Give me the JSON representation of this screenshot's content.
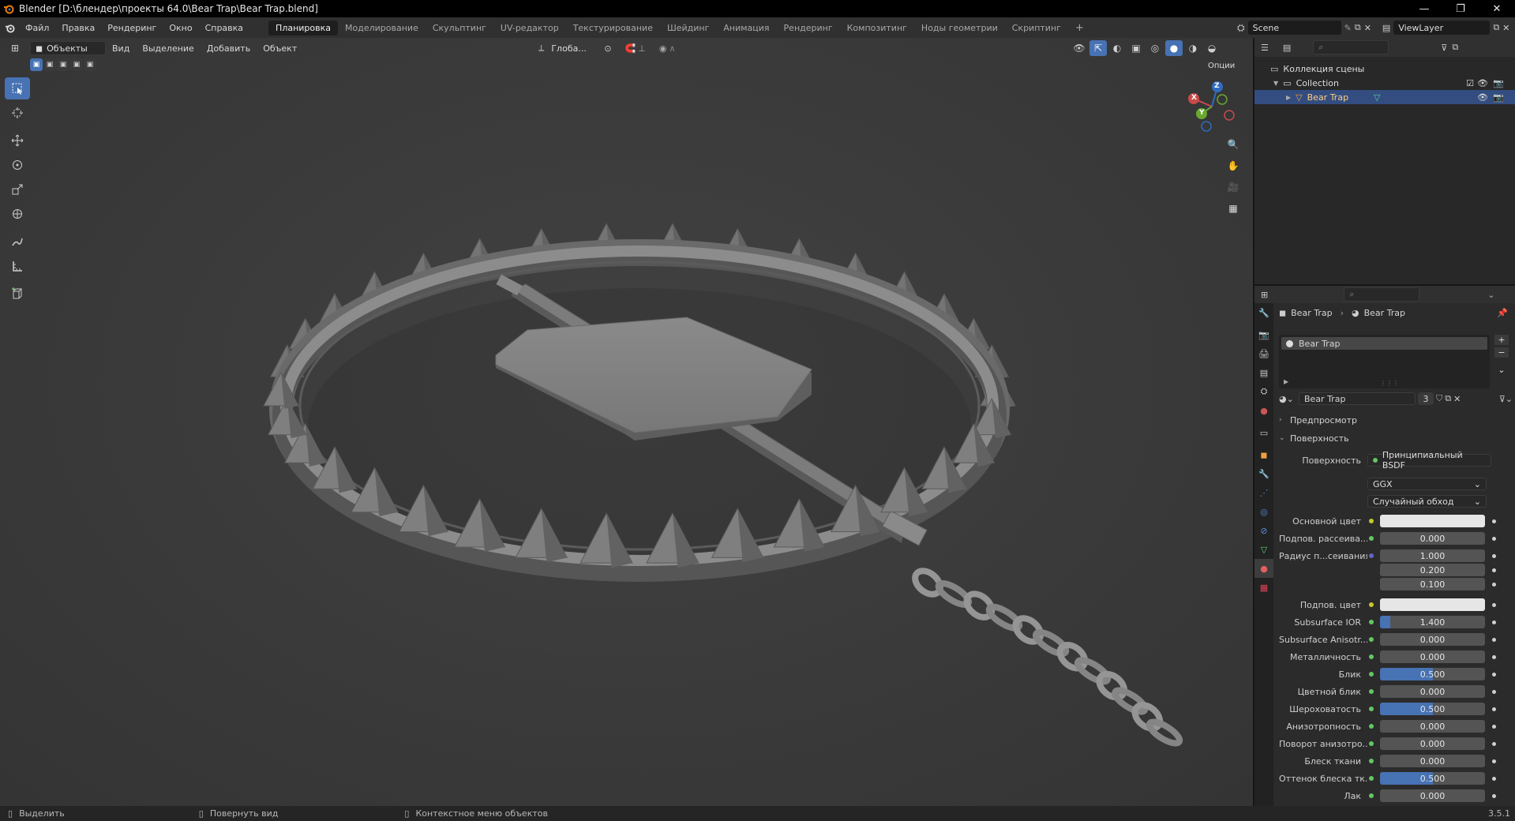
{
  "window": {
    "title": "Blender [D:\\блендер\\проекты 64.0\\Bear Trap\\Bear Trap.blend]",
    "controls": [
      "—",
      "❐",
      "✕"
    ]
  },
  "menu": [
    "Файл",
    "Правка",
    "Рендеринг",
    "Окно",
    "Справка"
  ],
  "workspaces": [
    "Планировка",
    "Моделирование",
    "Скульптинг",
    "UV-редактор",
    "Текстурирование",
    "Шейдинг",
    "Анимация",
    "Рендеринг",
    "Композитинг",
    "Ноды геометрии",
    "Скриптинг"
  ],
  "active_workspace": "Планировка",
  "add_workspace": "+",
  "scene": "Scene",
  "view_layer": "ViewLayer",
  "viewport": {
    "mode": "Объекты",
    "menus": [
      "Вид",
      "Выделение",
      "Добавить",
      "Объект"
    ],
    "transform_orientation": "Глоба...",
    "options": "Опции",
    "gizmo_axes": {
      "z": "Z",
      "x": "X",
      "y": "Y"
    }
  },
  "outliner": {
    "scene_collection": "Коллекция сцены",
    "collection": "Collection",
    "object": "Bear Trap"
  },
  "properties": {
    "breadcrumb_object": "Bear Trap",
    "breadcrumb_material": "Bear Trap",
    "material_slot": "Bear Trap",
    "material_name": "Bear Trap",
    "users": "3",
    "panel_preview": "Предпросмотр",
    "panel_surface": "Поверхность",
    "surface_label": "Поверхность",
    "surface_shader": "Принципиальный BSDF",
    "distribution": "GGX",
    "subsurface_method": "Случайный обход",
    "rows": [
      {
        "label": "Основной цвет",
        "type": "color",
        "dot": "y"
      },
      {
        "label": "Подпов. рассеива...",
        "type": "num",
        "value": "0.000",
        "fill": 0,
        "dot": "g"
      },
      {
        "label": "Радиус п...сеивания",
        "type": "num",
        "value": "1.000",
        "fill": 0,
        "dot": "b"
      },
      {
        "label": "",
        "type": "num",
        "value": "0.200",
        "fill": 0,
        "dot": ""
      },
      {
        "label": "",
        "type": "num",
        "value": "0.100",
        "fill": 0,
        "dot": ""
      },
      {
        "label": "Подпов. цвет",
        "type": "color",
        "dot": "y"
      },
      {
        "label": "Subsurface IOR",
        "type": "num",
        "value": "1.400",
        "fill": 0.1,
        "dot": "g"
      },
      {
        "label": "Subsurface Anisotr...",
        "type": "num",
        "value": "0.000",
        "fill": 0,
        "dot": "g"
      },
      {
        "label": "Металличность",
        "type": "num",
        "value": "0.000",
        "fill": 0,
        "dot": "g"
      },
      {
        "label": "Блик",
        "type": "num",
        "value": "0.500",
        "fill": 0.5,
        "dot": "g"
      },
      {
        "label": "Цветной блик",
        "type": "num",
        "value": "0.000",
        "fill": 0,
        "dot": "g"
      },
      {
        "label": "Шероховатость",
        "type": "num",
        "value": "0.500",
        "fill": 0.5,
        "dot": "g"
      },
      {
        "label": "Анизотропность",
        "type": "num",
        "value": "0.000",
        "fill": 0,
        "dot": "g"
      },
      {
        "label": "Поворот анизотро...",
        "type": "num",
        "value": "0.000",
        "fill": 0,
        "dot": "g"
      },
      {
        "label": "Блеск ткани",
        "type": "num",
        "value": "0.000",
        "fill": 0,
        "dot": "g"
      },
      {
        "label": "Оттенок блеска тк...",
        "type": "num",
        "value": "0.500",
        "fill": 0.5,
        "dot": "g"
      },
      {
        "label": "Лак",
        "type": "num",
        "value": "0.000",
        "fill": 0,
        "dot": "g"
      }
    ]
  },
  "status": {
    "select": "Выделить",
    "rotate": "Повернуть вид",
    "context": "Контекстное меню объектов",
    "version": "3.5.1"
  },
  "colors": {
    "accent": "#4772b3",
    "selection": "#334d80",
    "viewport_bg": "#3c3c3c"
  }
}
